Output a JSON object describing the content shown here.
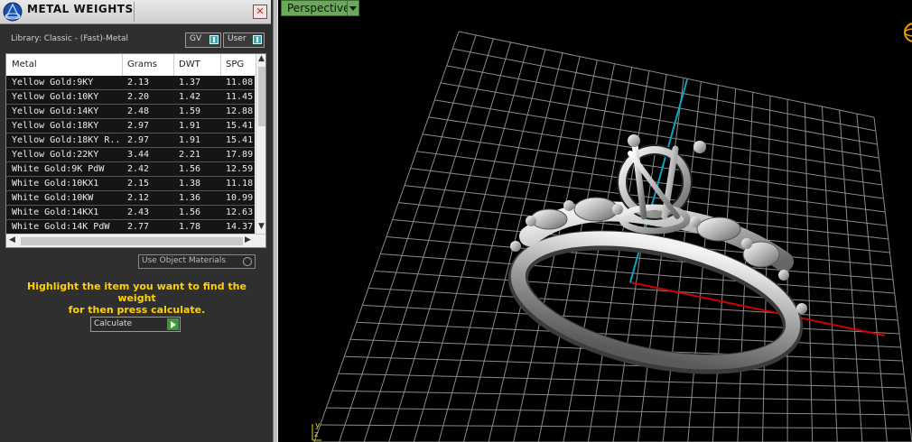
{
  "panel": {
    "title": "METAL WEIGHTS",
    "library": "Library: Classic - (Fast)-Metal",
    "toggle_gv": "GV",
    "toggle_user": "User",
    "use_object_materials": "Use Object Materials",
    "hint_line1": "Highlight the item you want to find the weight",
    "hint_line2": "for then press calculate.",
    "calculate_label": "Calculate"
  },
  "table": {
    "headers": [
      "Metal",
      "Grams",
      "DWT",
      "SPG"
    ],
    "rows": [
      {
        "metal": "Yellow Gold:9KY",
        "grams": "2.13",
        "dwt": "1.37",
        "spg": "11.08"
      },
      {
        "metal": "Yellow Gold:10KY",
        "grams": "2.20",
        "dwt": "1.42",
        "spg": "11.45"
      },
      {
        "metal": "Yellow Gold:14KY",
        "grams": "2.48",
        "dwt": "1.59",
        "spg": "12.88"
      },
      {
        "metal": "Yellow Gold:18KY",
        "grams": "2.97",
        "dwt": "1.91",
        "spg": "15.41"
      },
      {
        "metal": "Yellow Gold:18KY R...",
        "grams": "2.97",
        "dwt": "1.91",
        "spg": "15.41"
      },
      {
        "metal": "Yellow Gold:22KY",
        "grams": "3.44",
        "dwt": "2.21",
        "spg": "17.89"
      },
      {
        "metal": "White Gold:9K PdW",
        "grams": "2.42",
        "dwt": "1.56",
        "spg": "12.59"
      },
      {
        "metal": "White Gold:10KX1",
        "grams": "2.15",
        "dwt": "1.38",
        "spg": "11.18"
      },
      {
        "metal": "White Gold:10KW",
        "grams": "2.12",
        "dwt": "1.36",
        "spg": "10.99"
      },
      {
        "metal": "White Gold:14KX1",
        "grams": "2.43",
        "dwt": "1.56",
        "spg": "12.63"
      },
      {
        "metal": "White Gold:14K PdW",
        "grams": "2.77",
        "dwt": "1.78",
        "spg": "14.37"
      }
    ]
  },
  "viewport": {
    "label": "Perspective",
    "axis_y": "y",
    "axis_z": "z"
  },
  "colors": {
    "hint_text": "#ffd200",
    "grid": "#8a8a8a",
    "axis_x": "#d00000",
    "axis_y": "#0aa6c0",
    "viewport_tab": "#6aa85a"
  }
}
